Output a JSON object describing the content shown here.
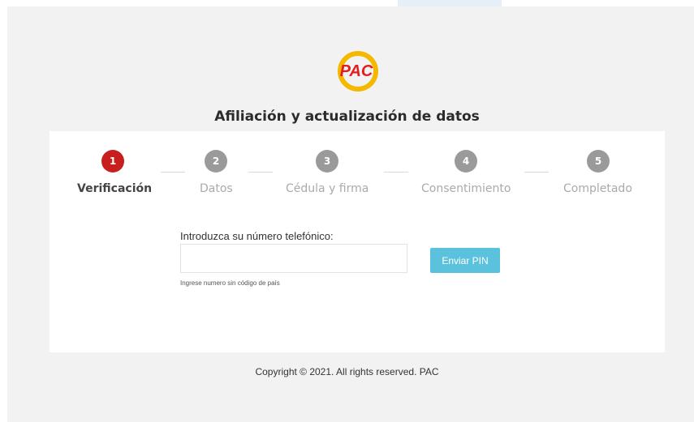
{
  "brand": {
    "logo_text": "PAC"
  },
  "page": {
    "title": "Afiliación y actualización de datos"
  },
  "steps": [
    {
      "number": "1",
      "label": "Verificación",
      "state": "active"
    },
    {
      "number": "2",
      "label": "Datos",
      "state": "inactive"
    },
    {
      "number": "3",
      "label": "Cédula y firma",
      "state": "inactive"
    },
    {
      "number": "4",
      "label": "Consentimiento",
      "state": "inactive"
    },
    {
      "number": "5",
      "label": "Completado",
      "state": "inactive"
    }
  ],
  "form": {
    "phone_label": "Introduzca su número telefónico:",
    "phone_value": "",
    "phone_placeholder": "",
    "hint": "Ingrese numero sin código de país",
    "send_button": "Enviar PIN"
  },
  "footer": {
    "copyright": "Copyright © 2021. All rights reserved. PAC"
  },
  "colors": {
    "active_step": "#c81e1e",
    "inactive_step": "#9a9a9a",
    "button": "#5bc2de",
    "logo_ring": "#f5b800",
    "logo_text": "#e21d1d"
  }
}
